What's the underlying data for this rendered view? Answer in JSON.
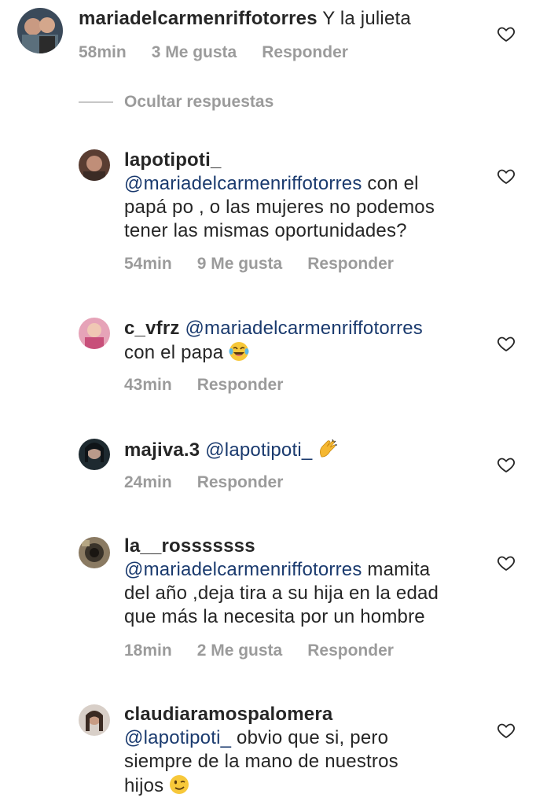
{
  "colors": {
    "text": "#262626",
    "meta": "#9b9b9b",
    "mention": "#1a3a6e",
    "divider": "#c7c7c7"
  },
  "icons": {
    "like": "heart-outline-icon",
    "laugh": "laughing-tears-emoji",
    "clap": "clapping-hands-emoji",
    "wink": "winking-face-emoji"
  },
  "top_comment": {
    "username": "mariadelcarmenriffotorres",
    "body": "Y la julieta",
    "time": "58min",
    "likes": "3 Me gusta",
    "reply": "Responder"
  },
  "hide_replies_label": "Ocultar respuestas",
  "replies": [
    {
      "username": "lapotipoti_",
      "mention": "@mariadelcarmenriffotorres",
      "body_line1": " con el",
      "body_line2": "papá po , o las mujeres no podemos",
      "body_line3": "tener las mismas oportunidades?",
      "time": "54min",
      "likes": "9 Me gusta",
      "reply": "Responder"
    },
    {
      "username": "c_vfrz",
      "mention": "@mariadelcarmenriffotorres",
      "body_line2": "con el papa",
      "time": "43min",
      "reply": "Responder"
    },
    {
      "username": "majiva.3",
      "mention": "@lapotipoti_",
      "time": "24min",
      "reply": "Responder"
    },
    {
      "username": "la__rosssssss",
      "mention": "@mariadelcarmenriffotorres",
      "body_line1": " mamita",
      "body_line2": "del año ,deja tira a su hija en la edad",
      "body_line3": "que más la necesita  por un hombre",
      "time": "18min",
      "likes": "2 Me gusta",
      "reply": "Responder"
    },
    {
      "username": "claudiaramospalomera",
      "mention": "@lapotipoti_",
      "body_line1": " obvio que si, pero",
      "body_line2": "siempre de la mano de nuestros",
      "body_line3": "hijos"
    }
  ]
}
